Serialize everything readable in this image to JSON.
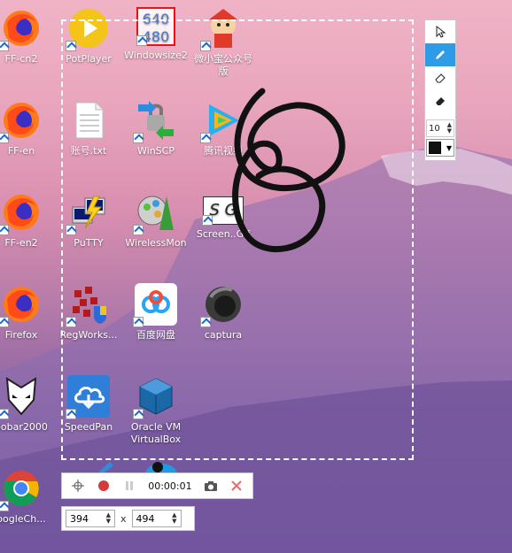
{
  "desktop": {
    "icons": [
      {
        "label": "FF-cn2",
        "icon": "firefox-icon"
      },
      {
        "label": "PotPlayer",
        "icon": "potplayer-icon"
      },
      {
        "label": "Windowsize2",
        "icon": "windowsize-icon"
      },
      {
        "label": "微小宝公众号版",
        "icon": "weixiaobao-icon"
      },
      {
        "label": "FF-en",
        "icon": "firefox-icon"
      },
      {
        "label": "账号.txt",
        "icon": "text-file-icon"
      },
      {
        "label": "WinSCP",
        "icon": "winscp-icon"
      },
      {
        "label": "腾讯视频",
        "icon": "tencent-video-icon"
      },
      {
        "label": "FF-en2",
        "icon": "firefox-icon"
      },
      {
        "label": "PuTTY",
        "icon": "putty-icon"
      },
      {
        "label": "WirelessMon",
        "icon": "wirelessmon-icon"
      },
      {
        "label": "Screen..Gif",
        "icon": "screentogif-icon"
      },
      {
        "label": "Firefox",
        "icon": "firefox-icon"
      },
      {
        "label": "RegWorks...",
        "icon": "regworks-icon"
      },
      {
        "label": "百度网盘",
        "icon": "baidu-pan-icon"
      },
      {
        "label": "captura",
        "icon": "captura-icon"
      },
      {
        "label": "oobar2000",
        "icon": "foobar-icon"
      },
      {
        "label": "SpeedPan",
        "icon": "speedpan-icon"
      },
      {
        "label": "Oracle VM VirtualBox",
        "icon": "virtualbox-icon"
      },
      {
        "label": "oogleCh...",
        "icon": "chrome-icon"
      }
    ],
    "windowsize_icon_text": [
      "640",
      "480"
    ],
    "screentogif_icon_text": "S G"
  },
  "tools": {
    "pointer_label": "Pointer",
    "pen_label": "Pen",
    "eraser_label": "Eraser",
    "eraser2_label": "Eraser fill",
    "stroke_width": "10",
    "stroke_color": "#111111"
  },
  "recorder": {
    "timer": "00:00:01"
  },
  "size": {
    "width": "394",
    "times": "x",
    "height": "494"
  },
  "colors": {
    "accent": "#2e9be6",
    "record": "#d33a3a",
    "close": "#e56b6b"
  }
}
